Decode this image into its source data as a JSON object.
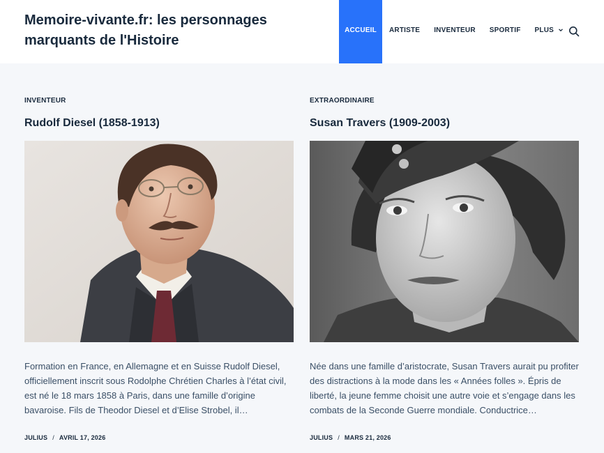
{
  "site": {
    "title": "Memoire-vivante.fr: les personnages marquants de l'Histoire"
  },
  "nav": {
    "items": [
      {
        "label": "ACCUEIL",
        "active": true
      },
      {
        "label": "ARTISTE"
      },
      {
        "label": "INVENTEUR"
      },
      {
        "label": "SPORTIF"
      },
      {
        "label": "PLUS"
      }
    ],
    "search_icon": "search-icon"
  },
  "colors": {
    "accent": "#2872fa",
    "heading": "#192a3d",
    "text": "#3a4f66",
    "background": "#f5f7fa"
  },
  "posts": [
    {
      "category": "INVENTEUR",
      "title": "Rudolf Diesel (1858-1913)",
      "excerpt": "Formation en France, en Allemagne et en Suisse Rudolf Diesel, officiellement inscrit sous Rodolphe Chrétien Charles à l’état civil, est né le 18 mars 1858 à Paris, dans une famille d’origine bavaroise. Fils de Theodor Diesel et d’Elise Strobel, il…",
      "author": "JULIUS",
      "separator": "/",
      "date": "AVRIL 17, 2026"
    },
    {
      "category": "EXTRAORDINAIRE",
      "title": "Susan Travers (1909-2003)",
      "excerpt": "Née dans une famille d’aristocrate, Susan Travers aurait pu profiter des distractions à la mode dans les « Années folles ». Épris de liberté, la jeune femme choisit une autre voie et s’engage dans les combats de la Seconde Guerre mondiale. Conductrice…",
      "author": "JULIUS",
      "separator": "/",
      "date": "MARS 21, 2026"
    }
  ]
}
